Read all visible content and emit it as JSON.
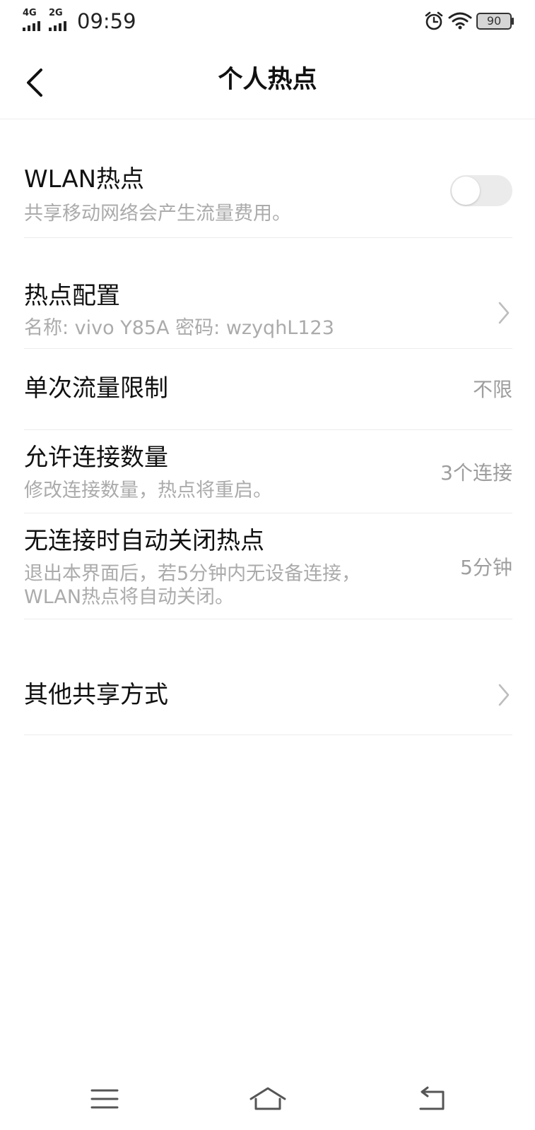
{
  "status_bar": {
    "network1": "4G",
    "network2": "2G",
    "time": "09:59",
    "battery": "90",
    "alarm_icon": "alarm-icon",
    "wifi_icon": "wifi-icon",
    "battery_icon": "battery-icon"
  },
  "header": {
    "title": "个人热点",
    "back_icon": "back-arrow-icon"
  },
  "wlan_hotspot": {
    "title": "WLAN热点",
    "subtitle": "共享移动网络会产生流量费用。",
    "enabled": false
  },
  "hotspot_config": {
    "title": "热点配置",
    "subtitle": "名称: vivo Y85A  密码: wzyqhL123"
  },
  "data_limit": {
    "title": "单次流量限制",
    "value": "不限"
  },
  "max_connections": {
    "title": "允许连接数量",
    "subtitle": "修改连接数量，热点将重启。",
    "value": "3个连接"
  },
  "auto_off": {
    "title": "无连接时自动关闭热点",
    "subtitle_line1": "退出本界面后，若5分钟内无设备连接，",
    "subtitle_line2": "WLAN热点将自动关闭。",
    "value": "5分钟"
  },
  "other_sharing": {
    "title": "其他共享方式"
  },
  "nav_bar": {
    "menu_icon": "menu-icon",
    "home_icon": "home-icon",
    "back_icon": "back-icon"
  },
  "colors": {
    "background": "#ffffff",
    "title_text": "#111111",
    "secondary_text": "#ababab",
    "value_text": "#9e9e9e",
    "divider": "#ececec",
    "toggle_off": "#ebebeb"
  }
}
